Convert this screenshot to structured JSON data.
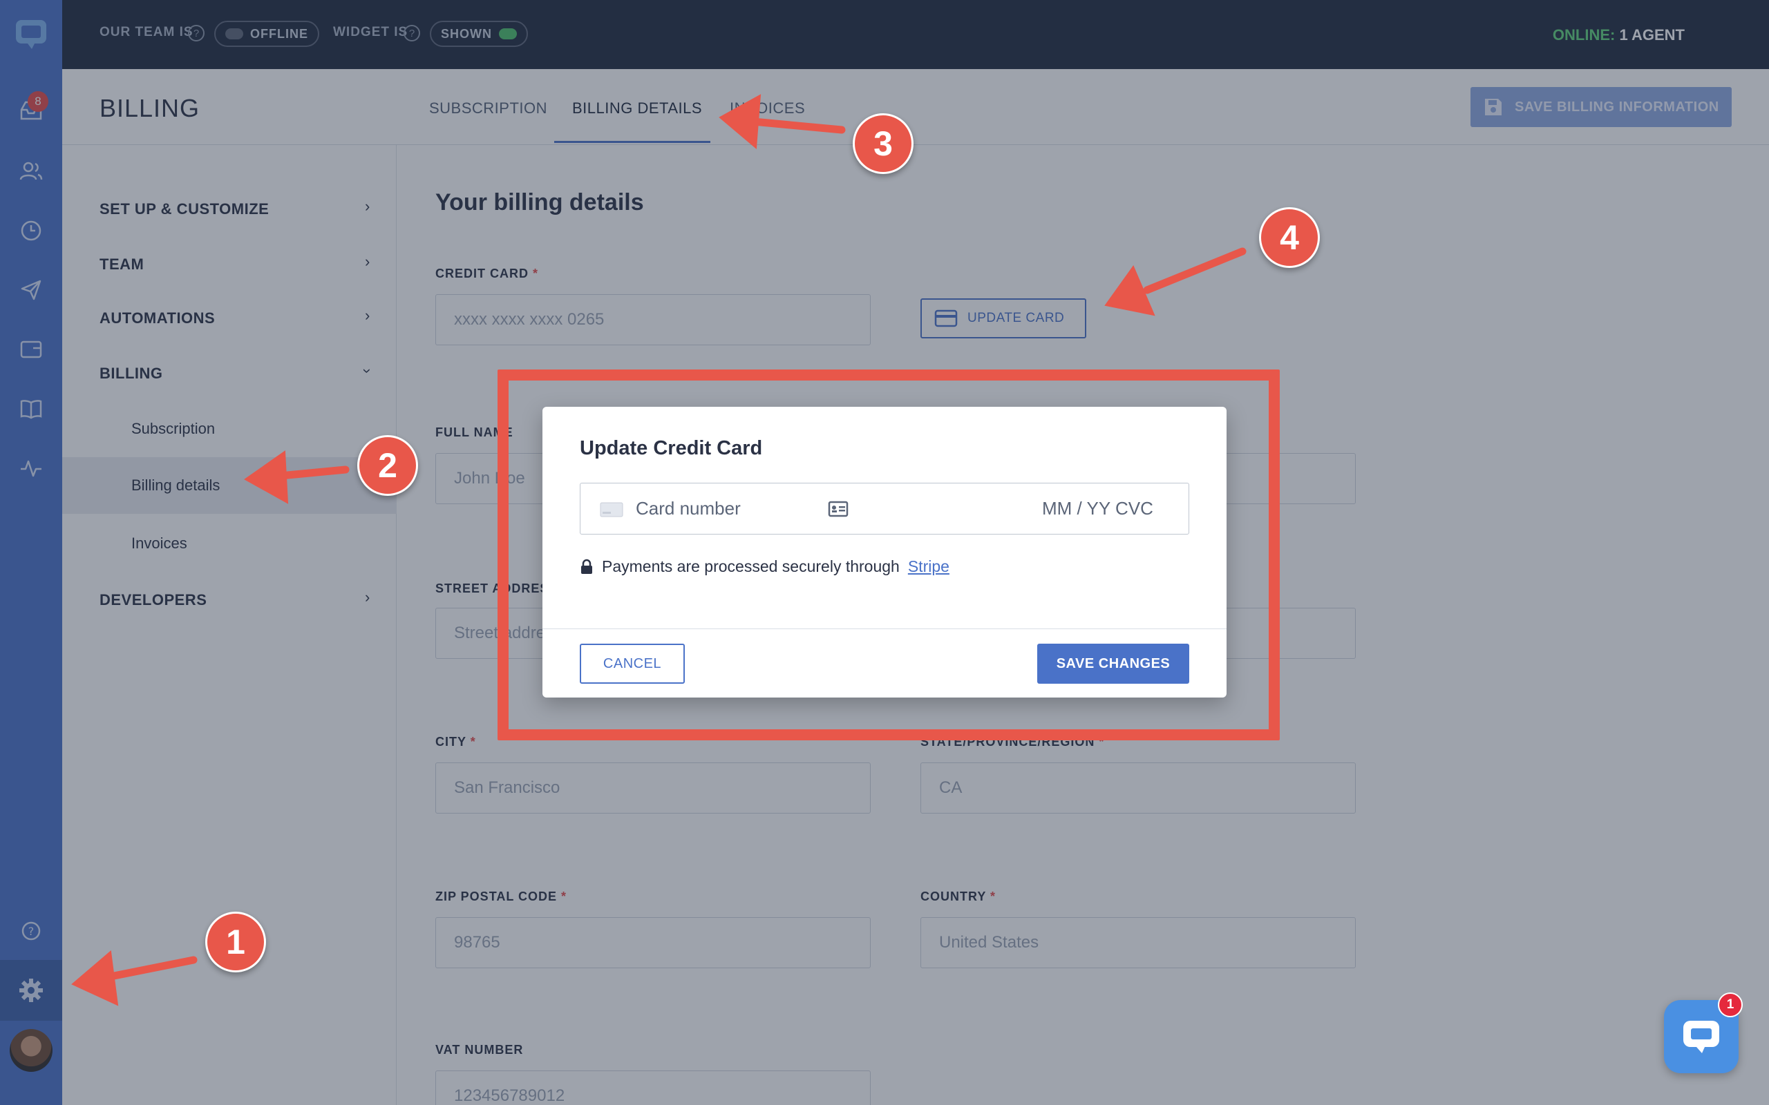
{
  "topbar": {
    "team_label": "OUR TEAM IS",
    "team_status": "OFFLINE",
    "widget_label": "WIDGET IS",
    "widget_status": "SHOWN",
    "online_label": "ONLINE:",
    "online_value": "1 AGENT"
  },
  "rail": {
    "inbox_badge": "8",
    "icons": [
      "chat-logo-icon",
      "inbox-icon",
      "people-icon",
      "clock-icon",
      "send-icon",
      "card-icon",
      "book-icon",
      "activity-icon",
      "help-icon",
      "gear-icon"
    ]
  },
  "header": {
    "title": "BILLING",
    "tabs": [
      {
        "label": "SUBSCRIPTION"
      },
      {
        "label": "BILLING DETAILS"
      },
      {
        "label": "INVOICES"
      }
    ],
    "save_label": "SAVE BILLING INFORMATION"
  },
  "sidebar": {
    "items": [
      {
        "label": "SET UP & CUSTOMIZE"
      },
      {
        "label": "TEAM"
      },
      {
        "label": "AUTOMATIONS"
      },
      {
        "label": "BILLING"
      },
      {
        "label": "DEVELOPERS"
      }
    ],
    "billing_sub": [
      {
        "label": "Subscription"
      },
      {
        "label": "Billing details"
      },
      {
        "label": "Invoices"
      }
    ]
  },
  "main": {
    "heading": "Your billing details",
    "credit_card_label": "CREDIT CARD",
    "credit_card_value": "xxxx xxxx xxxx 0265",
    "update_card_label": "UPDATE CARD",
    "full_name_label": "FULL NAME",
    "full_name_value": "John Doe",
    "street_label": "STREET ADDRESS",
    "street_value": "Street address",
    "city_label": "CITY",
    "city_value": "San Francisco",
    "state_label": "STATE/PROVINCE/REGION",
    "state_value": "CA",
    "zip_label": "ZIP POSTAL CODE",
    "zip_value": "98765",
    "country_label": "COUNTRY",
    "country_value": "United States",
    "vat_label": "VAT NUMBER",
    "vat_value": "123456789012",
    "required_mark": "*"
  },
  "modal": {
    "title": "Update Credit Card",
    "card_placeholder": "Card number",
    "exp_placeholder": "MM / YY  CVC",
    "secure_text": "Payments are processed securely through",
    "secure_link": "Stripe",
    "cancel_label": "CANCEL",
    "save_label": "SAVE CHANGES"
  },
  "annotations": [
    "1",
    "2",
    "3",
    "4"
  ],
  "chat": {
    "badge": "1"
  },
  "colors": {
    "accent": "#4a72c8",
    "annotation": "#e8574a",
    "online": "#5fd27a"
  }
}
